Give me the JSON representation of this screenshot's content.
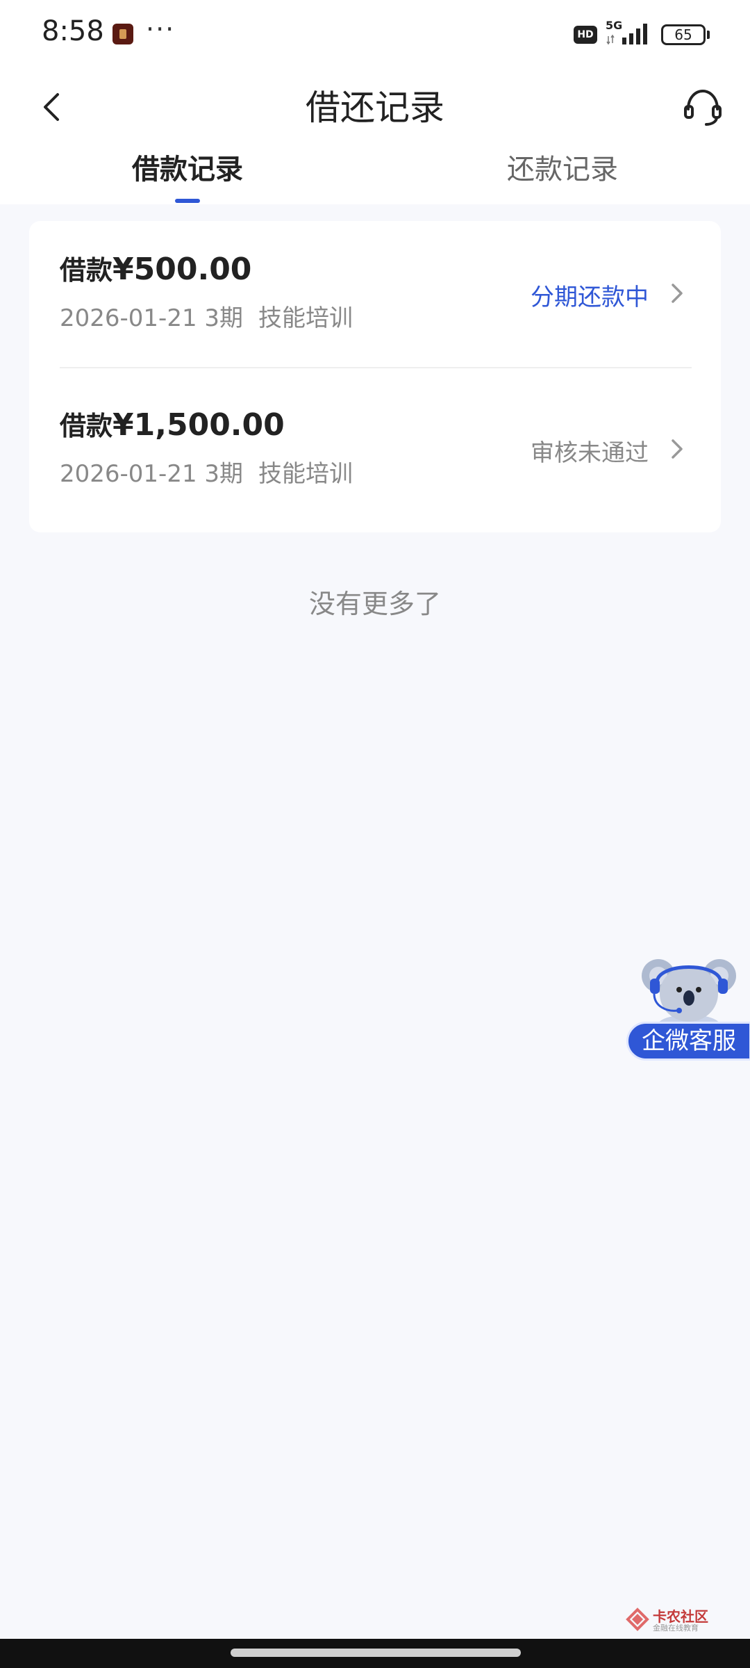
{
  "status_bar": {
    "time": "8:58",
    "more": "···",
    "hd": "HD",
    "network": "5G",
    "battery": "65"
  },
  "header": {
    "title": "借还记录",
    "back_icon": "chevron-left-icon",
    "service_icon": "headset-icon"
  },
  "tabs": [
    {
      "label": "借款记录",
      "active": true
    },
    {
      "label": "还款记录",
      "active": false
    }
  ],
  "records": [
    {
      "amount_label": "借款",
      "amount": "¥500.00",
      "date": "2026-01-21",
      "periods": "3期",
      "purpose": "技能培训",
      "status": "分期还款中",
      "status_color": "#2f57d6"
    },
    {
      "amount_label": "借款",
      "amount": "¥1,500.00",
      "date": "2026-01-21",
      "periods": "3期",
      "purpose": "技能培训",
      "status": "审核未通过",
      "status_color": "#888888"
    }
  ],
  "list_footer": "没有更多了",
  "floating_service": {
    "label": "企微客服",
    "icon": "koala-mascot-icon"
  },
  "watermark": {
    "text": "卡农社区",
    "subtext": "金融在线教育"
  },
  "colors": {
    "accent": "#2f57d6",
    "background": "#f7f8fc"
  }
}
